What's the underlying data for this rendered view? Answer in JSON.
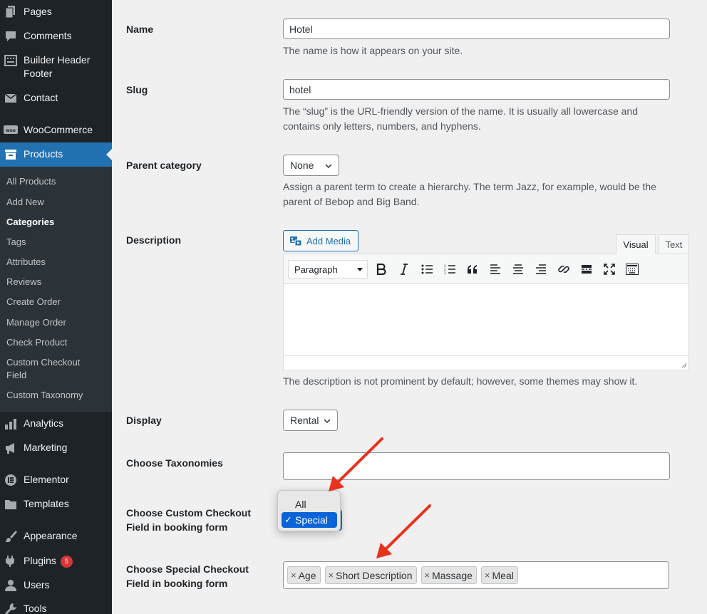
{
  "sidebar": {
    "menu": [
      {
        "label": "Pages",
        "icon": "pages-icon"
      },
      {
        "label": "Comments",
        "icon": "comments-icon"
      },
      {
        "label": "Builder Header Footer",
        "icon": "builder-icon"
      },
      {
        "label": "Contact",
        "icon": "mail-icon"
      },
      {
        "label": "WooCommerce",
        "icon": "woo-icon"
      },
      {
        "label": "Products",
        "icon": "archive-icon"
      },
      {
        "label": "Analytics",
        "icon": "bar-chart-icon"
      },
      {
        "label": "Marketing",
        "icon": "megaphone-icon"
      },
      {
        "label": "Elementor",
        "icon": "elementor-icon"
      },
      {
        "label": "Templates",
        "icon": "folder-icon"
      },
      {
        "label": "Appearance",
        "icon": "paintbrush-icon"
      },
      {
        "label": "Plugins",
        "icon": "plugin-icon",
        "badge": "5"
      },
      {
        "label": "Users",
        "icon": "user-icon"
      },
      {
        "label": "Tools",
        "icon": "wrench-icon"
      }
    ],
    "submenu": [
      "All Products",
      "Add New",
      "Categories",
      "Tags",
      "Attributes",
      "Reviews",
      "Create Order",
      "Manage Order",
      "Check Product",
      "Custom Checkout Field",
      "Custom Taxonomy"
    ]
  },
  "form": {
    "name": {
      "label": "Name",
      "value": "Hotel",
      "help": "The name is how it appears on your site."
    },
    "slug": {
      "label": "Slug",
      "value": "hotel",
      "help": "The “slug” is the URL-friendly version of the name. It is usually all lowercase and contains only letters, numbers, and hyphens."
    },
    "parent": {
      "label": "Parent category",
      "value": "None",
      "help": "Assign a parent term to create a hierarchy. The term Jazz, for example, would be the parent of Bebop and Big Band."
    },
    "description": {
      "label": "Description",
      "add_media": "Add Media",
      "tab_visual": "Visual",
      "tab_text": "Text",
      "format_select": "Paragraph",
      "help": "The description is not prominent by default; however, some themes may show it."
    },
    "display": {
      "label": "Display",
      "value": "Rental"
    },
    "taxonomies": {
      "label": "Choose Taxonomies",
      "value": ""
    },
    "custom_checkout": {
      "label": "Choose Custom Checkout Field in booking form",
      "options": [
        "All",
        "Special"
      ],
      "selected": "Special",
      "check": "✓"
    },
    "special_checkout": {
      "label": "Choose Special Checkout Field in booking form",
      "tags": [
        "Age",
        "Short Description",
        "Massage",
        "Meal"
      ],
      "remove_glyph": "×"
    }
  },
  "colors": {
    "accent": "#2271b1",
    "sidebar": "#1d2327",
    "annotation_arrow": "#e8321e",
    "badge": "#d63638"
  }
}
